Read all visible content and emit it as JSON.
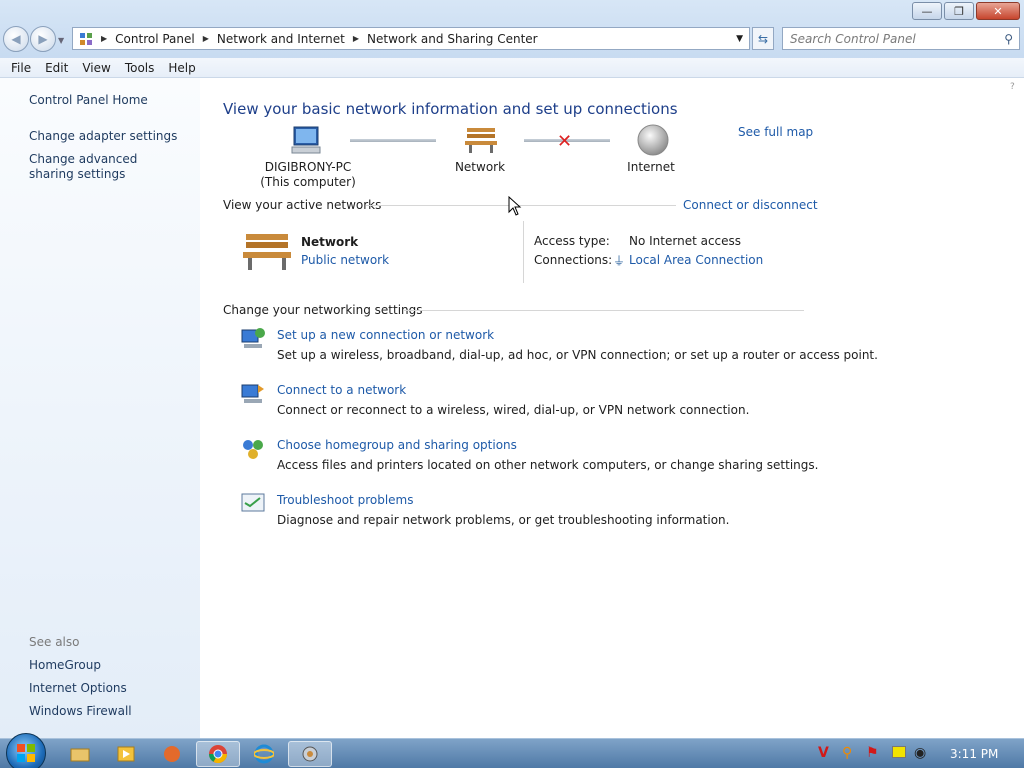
{
  "window": {
    "title_buttons": {
      "minimize": "—",
      "restore": "❐",
      "close": "✕"
    }
  },
  "nav": {
    "breadcrumbs": [
      "Control Panel",
      "Network and Internet",
      "Network and Sharing Center"
    ],
    "search_placeholder": "Search Control Panel"
  },
  "menu": [
    "File",
    "Edit",
    "View",
    "Tools",
    "Help"
  ],
  "sidebar": {
    "links": [
      "Control Panel Home",
      "Change adapter settings",
      "Change advanced sharing settings"
    ],
    "see_also_label": "See also",
    "see_also": [
      "HomeGroup",
      "Internet Options",
      "Windows Firewall"
    ]
  },
  "main": {
    "title": "View your basic network information and set up connections",
    "see_full_map": "See full map",
    "map": {
      "computer_name": "DIGIBRONY-PC",
      "computer_sub": "(This computer)",
      "network": "Network",
      "internet": "Internet"
    },
    "active_networks_label": "View your active networks",
    "connect_or_disconnect": "Connect or disconnect",
    "active_network": {
      "name": "Network",
      "type": "Public network",
      "access_type_label": "Access type:",
      "access_type": "No Internet access",
      "connections_label": "Connections:",
      "connection": "Local Area Connection"
    },
    "change_settings_label": "Change your networking settings",
    "tasks": [
      {
        "link": "Set up a new connection or network",
        "desc": "Set up a wireless, broadband, dial-up, ad hoc, or VPN connection; or set up a router or access point."
      },
      {
        "link": "Connect to a network",
        "desc": "Connect or reconnect to a wireless, wired, dial-up, or VPN network connection."
      },
      {
        "link": "Choose homegroup and sharing options",
        "desc": "Access files and printers located on other network computers, or change sharing settings."
      },
      {
        "link": "Troubleshoot problems",
        "desc": "Diagnose and repair network problems, or get troubleshooting information."
      }
    ]
  },
  "taskbar": {
    "clock": "3:11 PM"
  }
}
